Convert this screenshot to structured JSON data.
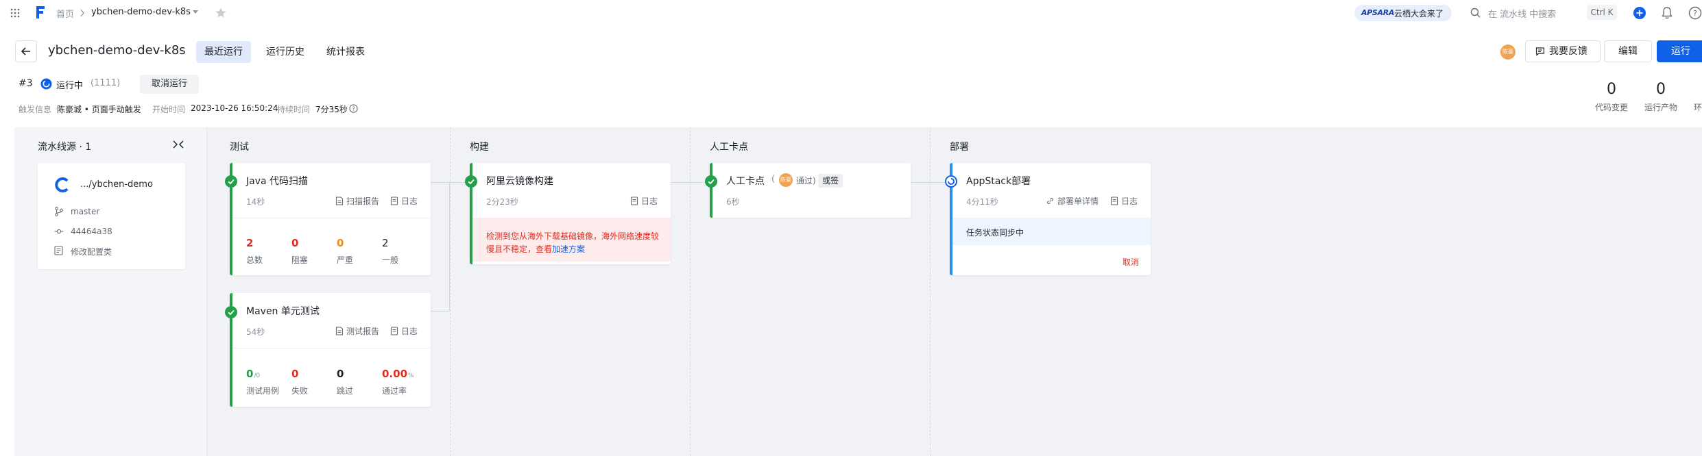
{
  "nav": {
    "breadcrumb_home": "首页",
    "pipeline_name": "ybchen-demo-dev-k8s",
    "promo_brand": "APSARA",
    "promo_text": "云栖大会来了",
    "search_placeholder": "在 流水线 中搜索",
    "search_shortcut": "Ctrl K"
  },
  "header": {
    "title": "ybchen-demo-dev-k8s",
    "tabs": [
      "最近运行",
      "运行历史",
      "统计报表"
    ],
    "avatar_text": "陈豪",
    "feedback_label": "我要反馈",
    "edit_label": "编辑",
    "run_label": "运行"
  },
  "run": {
    "number": "#3",
    "status": "运行中",
    "count": "(1111)",
    "cancel_label": "取消运行",
    "trigger_label": "触发信息",
    "trigger_value": "陈豪城 • 页面手动触发",
    "start_label": "开始时间",
    "start_value": "2023-10-26 16:50:24",
    "duration_label": "持续时间",
    "duration_value": "7分35秒"
  },
  "stats": [
    {
      "value": "0",
      "label": "代码变更"
    },
    {
      "value": "0",
      "label": "运行产物"
    },
    {
      "label": "环"
    }
  ],
  "source": {
    "header": "流水线源 · 1",
    "repo": ".../ybchen-demo",
    "branch": "master",
    "commit": "44464a38",
    "message": "修改配置类"
  },
  "stages": [
    "测试",
    "构建",
    "人工卡点",
    "部署"
  ],
  "jobs": {
    "java_scan": {
      "title": "Java 代码扫描",
      "duration": "14秒",
      "report_link": "扫描报告",
      "log_link": "日志",
      "metrics": [
        {
          "value": "2",
          "label": "总数",
          "color": "#e02c1f"
        },
        {
          "value": "0",
          "label": "阻塞",
          "color": "#e02c1f"
        },
        {
          "value": "0",
          "label": "严重",
          "color": "#f28b14"
        },
        {
          "value": "2",
          "label": "一般",
          "color": "#1f2329"
        }
      ]
    },
    "maven_test": {
      "title": "Maven 单元测试",
      "duration": "54秒",
      "report_link": "测试报告",
      "log_link": "日志",
      "metrics": [
        {
          "value": "0",
          "unit": "/0",
          "label": "测试用例",
          "color": "#24a148"
        },
        {
          "value": "0",
          "label": "失败",
          "color": "#e02c1f"
        },
        {
          "value": "0",
          "label": "跳过",
          "color": "#1f2329"
        },
        {
          "value": "0.00",
          "unit": "%",
          "label": "通过率",
          "color": "#e02c1f"
        }
      ]
    },
    "image_build": {
      "title": "阿里云镜像构建",
      "duration": "2分23秒",
      "log_link": "日志",
      "warning_line1": "检测到您从海外下载基础镜像，海外网络速度较",
      "warning_line2": "慢且不稳定，查看",
      "warning_link": "加速方案"
    },
    "manual_gate": {
      "title": "人工卡点",
      "avatar_text": "陈豪",
      "approved": "通过)",
      "paren_open": "(",
      "tag": "或签",
      "duration": "6秒"
    },
    "appstack_deploy": {
      "title": "AppStack部署",
      "duration": "4分11秒",
      "detail_link": "部署单详情",
      "log_link": "日志",
      "sync_text": "任务状态同步中",
      "cancel_label": "取消"
    }
  },
  "colors": {
    "accent": "#1161e8",
    "success": "#24a148",
    "danger": "#e02c1f",
    "warning": "#f28b14",
    "running": "#2d8cf0"
  }
}
